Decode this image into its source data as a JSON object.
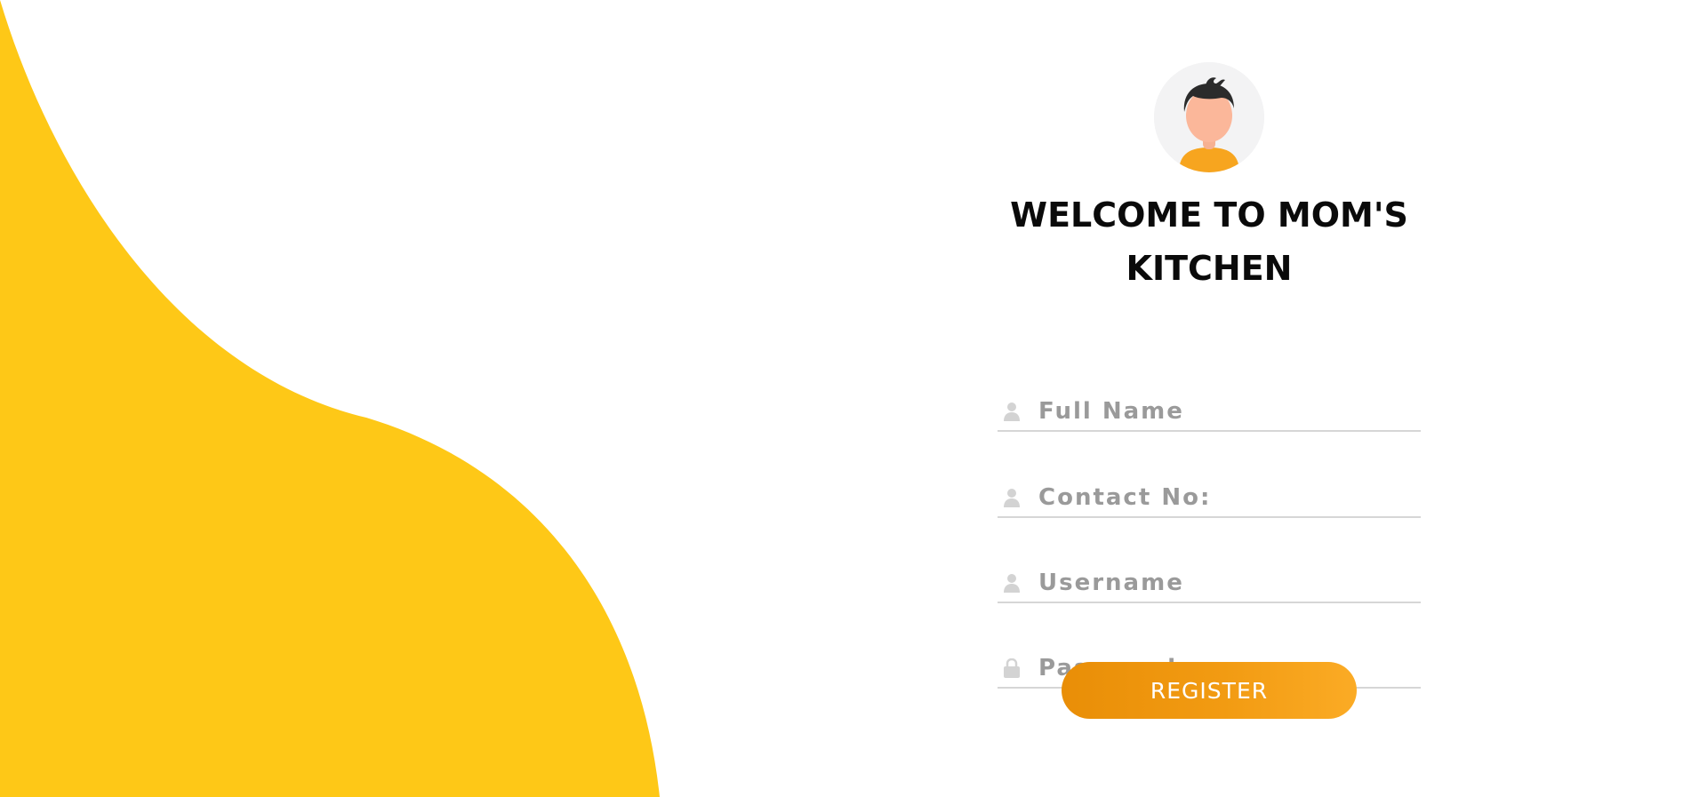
{
  "colors": {
    "wave": "#fec817",
    "button_gradient_start": "#e98e07",
    "button_gradient_end": "#fbab25",
    "heading": "#0a0a0a",
    "placeholder": "#9a9a9a",
    "underline": "#d6d6d6"
  },
  "avatar": {
    "icon": "user-avatar-icon"
  },
  "heading": {
    "title": "WELCOME TO MOM'S KITCHEN"
  },
  "form": {
    "fields": [
      {
        "placeholder": "Full Name",
        "value": "",
        "icon": "user-icon"
      },
      {
        "placeholder": "Contact No:",
        "value": "",
        "icon": "user-icon"
      },
      {
        "placeholder": "Username",
        "value": "",
        "icon": "user-icon"
      },
      {
        "placeholder": "Password",
        "value": "",
        "icon": "lock-icon"
      }
    ],
    "submit_label": "REGISTER"
  }
}
